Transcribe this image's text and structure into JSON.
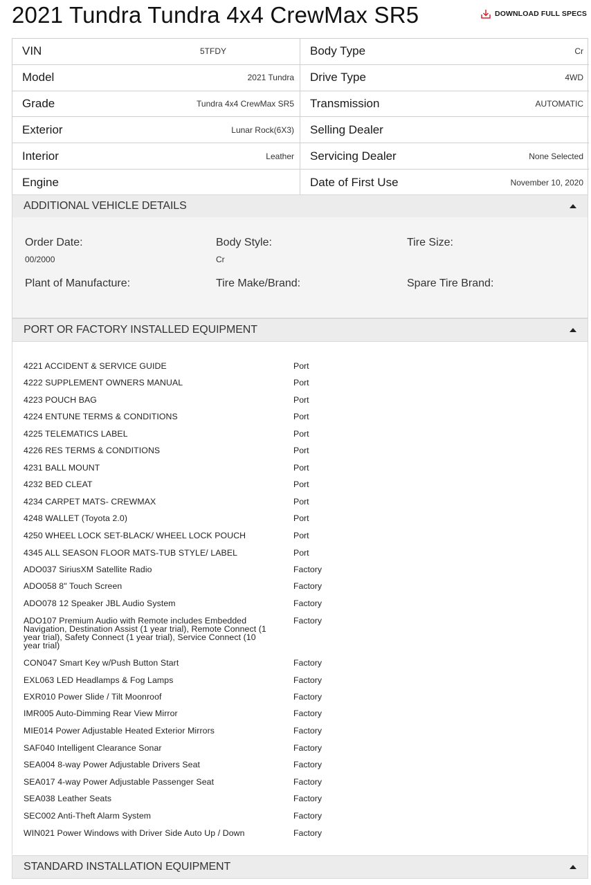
{
  "page": {
    "title": "2021 Tundra Tundra 4x4 CrewMax SR5",
    "download_label": "DOWNLOAD FULL SPECS"
  },
  "specs": {
    "vin": {
      "label": "VIN",
      "value": "5TFDY"
    },
    "body_type": {
      "label": "Body Type",
      "value": "Cr"
    },
    "model": {
      "label": "Model",
      "value": "2021 Tundra"
    },
    "drive_type": {
      "label": "Drive Type",
      "value": "4WD"
    },
    "grade": {
      "label": "Grade",
      "value": "Tundra 4x4 CrewMax SR5"
    },
    "transmission": {
      "label": "Transmission",
      "value": "AUTOMATIC"
    },
    "exterior": {
      "label": "Exterior",
      "value": "Lunar Rock(6X3)"
    },
    "selling_dealer": {
      "label": "Selling Dealer",
      "value": ""
    },
    "interior": {
      "label": "Interior",
      "value": "Leather"
    },
    "servicing_dealer": {
      "label": "Servicing Dealer",
      "value": "None Selected"
    },
    "engine": {
      "label": "Engine",
      "value": ""
    },
    "first_use": {
      "label": "Date of First Use",
      "value": "November 10, 2020"
    }
  },
  "additional": {
    "title": "ADDITIONAL VEHICLE DETAILS",
    "order_date": {
      "label": "Order Date:",
      "value": "00/2000"
    },
    "body_style": {
      "label": "Body Style:",
      "value": "Cr"
    },
    "tire_size": {
      "label": "Tire Size:",
      "value": ""
    },
    "plant": {
      "label": "Plant of Manufacture:",
      "value": ""
    },
    "tire_make": {
      "label": "Tire Make/Brand:",
      "value": ""
    },
    "spare_tire": {
      "label": "Spare Tire Brand:",
      "value": ""
    }
  },
  "equipment": {
    "title": "PORT OR FACTORY INSTALLED EQUIPMENT",
    "items": [
      {
        "name": "4221 ACCIDENT & SERVICE GUIDE",
        "type": "Port"
      },
      {
        "name": "4222 SUPPLEMENT OWNERS MANUAL",
        "type": "Port"
      },
      {
        "name": "4223 POUCH BAG",
        "type": "Port"
      },
      {
        "name": "4224 ENTUNE TERMS & CONDITIONS",
        "type": "Port"
      },
      {
        "name": "4225 TELEMATICS LABEL",
        "type": "Port"
      },
      {
        "name": "4226 RES TERMS & CONDITIONS",
        "type": "Port"
      },
      {
        "name": "4231 BALL MOUNT",
        "type": "Port"
      },
      {
        "name": "4232 BED CLEAT",
        "type": "Port"
      },
      {
        "name": "4234 CARPET MATS- CREWMAX",
        "type": "Port"
      },
      {
        "name": "4248 WALLET (Toyota 2.0)",
        "type": "Port"
      },
      {
        "name": "4250 WHEEL LOCK SET-BLACK/ WHEEL LOCK POUCH",
        "type": "Port"
      },
      {
        "name": "4345 ALL SEASON FLOOR MATS-TUB STYLE/ LABEL",
        "type": "Port"
      },
      {
        "name": "ADO037 SiriusXM Satellite Radio",
        "type": "Factory"
      },
      {
        "name": "ADO058 8\" Touch Screen",
        "type": "Factory"
      },
      {
        "name": "ADO078 12 Speaker JBL Audio System",
        "type": "Factory"
      },
      {
        "name": "ADO107 Premium Audio with Remote  includes Embedded Navigation, Destination Assist (1 year trial), Remote Connect (1 year trial), Safety Connect (1 year trial), Service Connect (10 year trial)",
        "type": "Factory"
      },
      {
        "name": "CON047 Smart Key w/Push Button Start",
        "type": "Factory"
      },
      {
        "name": "EXL063 LED Headlamps & Fog Lamps",
        "type": "Factory"
      },
      {
        "name": "EXR010 Power Slide / Tilt Moonroof",
        "type": "Factory"
      },
      {
        "name": "IMR005 Auto-Dimming Rear View Mirror",
        "type": "Factory"
      },
      {
        "name": "MIE014 Power Adjustable Heated Exterior Mirrors",
        "type": "Factory"
      },
      {
        "name": "SAF040 Intelligent Clearance Sonar",
        "type": "Factory"
      },
      {
        "name": "SEA004 8-way Power Adjustable Drivers Seat",
        "type": "Factory"
      },
      {
        "name": "SEA017 4-way Power Adjustable Passenger Seat",
        "type": "Factory"
      },
      {
        "name": "SEA038 Leather Seats",
        "type": "Factory"
      },
      {
        "name": "SEC002 Anti-Theft Alarm System",
        "type": "Factory"
      },
      {
        "name": "WIN021 Power Windows with Driver Side Auto Up / Down",
        "type": "Factory"
      }
    ]
  },
  "standard": {
    "title": "STANDARD INSTALLATION EQUIPMENT"
  },
  "colors": {
    "download_icon": "#d9232e",
    "section_bg": "#ececec",
    "border": "#cfcfcf"
  }
}
